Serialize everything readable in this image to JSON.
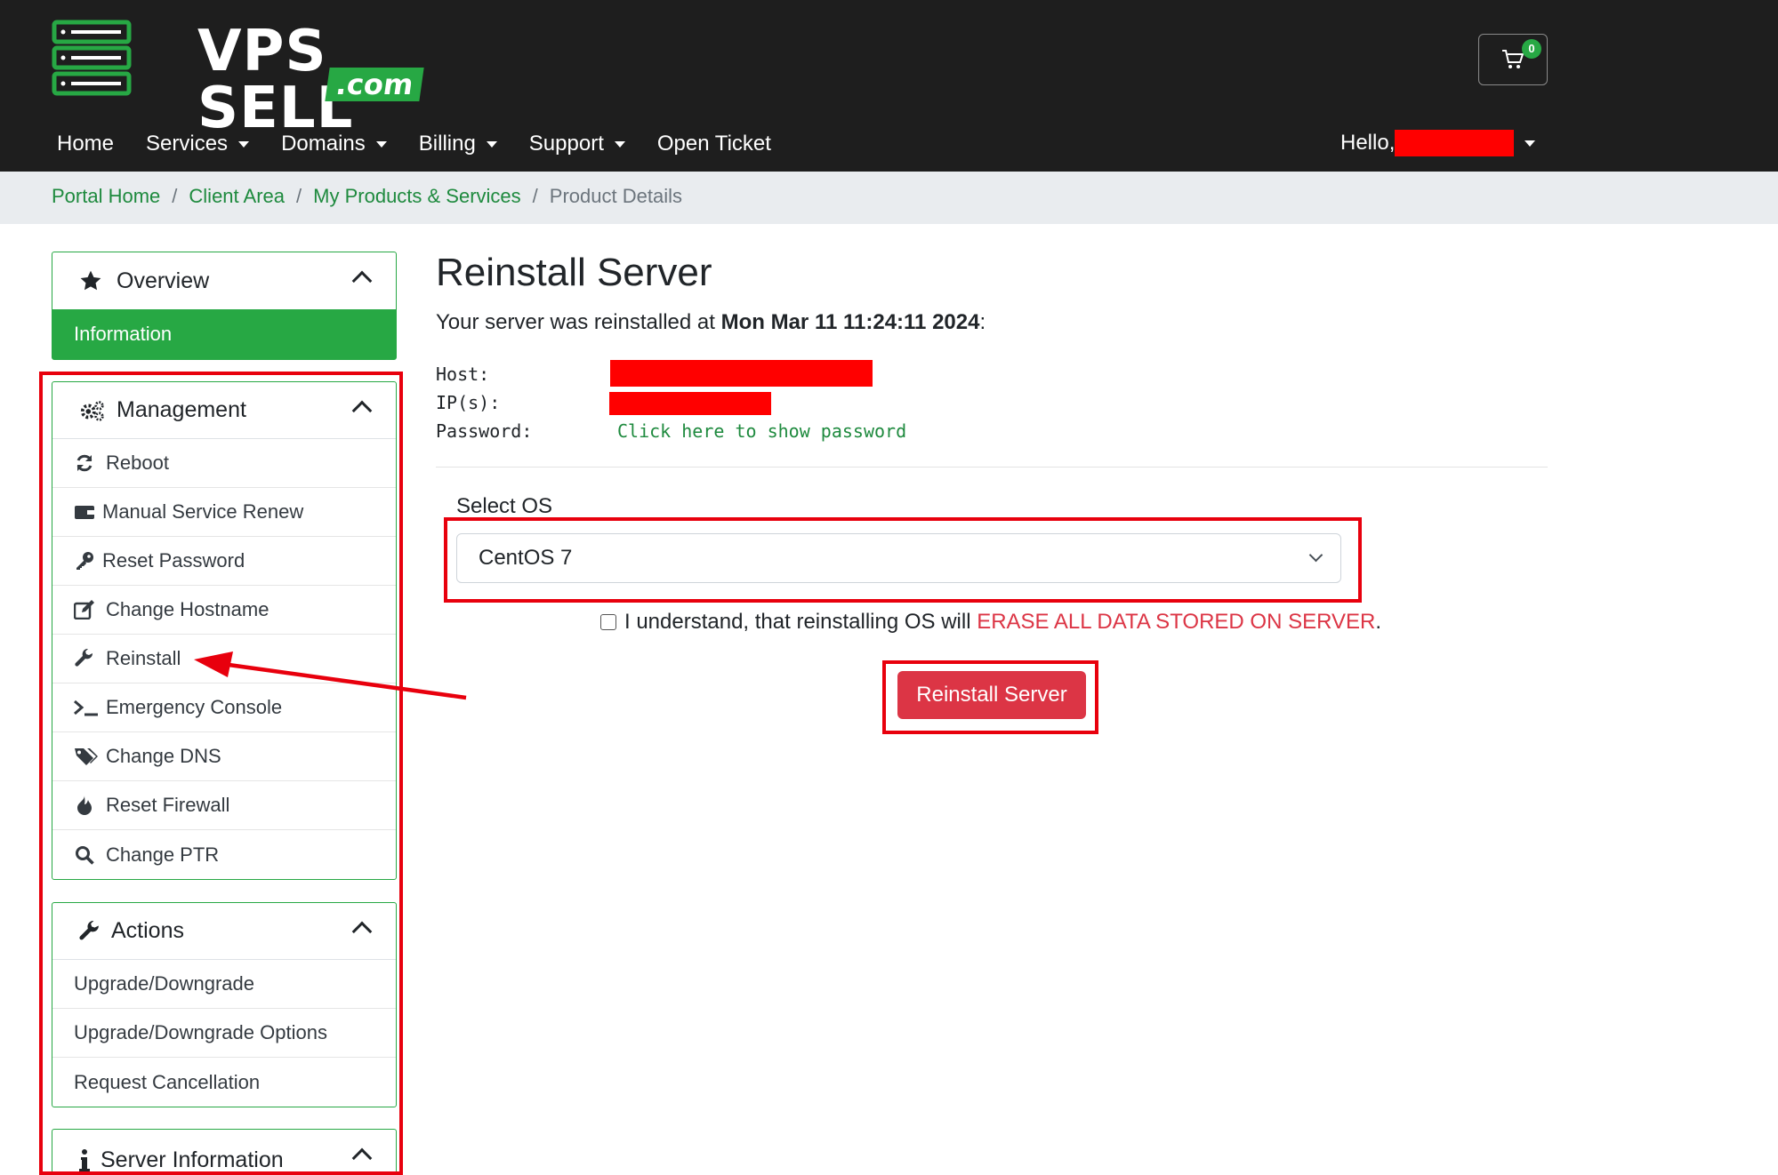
{
  "brand": {
    "name": "VPS SELL",
    "suffix": ".com"
  },
  "cart": {
    "count": "0"
  },
  "nav": {
    "items": [
      {
        "label": "Home",
        "dropdown": false
      },
      {
        "label": "Services",
        "dropdown": true
      },
      {
        "label": "Domains",
        "dropdown": true
      },
      {
        "label": "Billing",
        "dropdown": true
      },
      {
        "label": "Support",
        "dropdown": true
      },
      {
        "label": "Open Ticket",
        "dropdown": false
      }
    ],
    "greeting": "Hello,"
  },
  "breadcrumb": {
    "items": [
      "Portal Home",
      "Client Area",
      "My Products & Services"
    ],
    "current": "Product Details",
    "separator": "/"
  },
  "sidebar": {
    "overview": {
      "title": "Overview",
      "icon": "star-icon",
      "active_item": "Information"
    },
    "management": {
      "title": "Management",
      "icon": "gears-icon",
      "items": [
        {
          "label": "Reboot",
          "icon": "sync-icon"
        },
        {
          "label": "Manual Service Renew",
          "icon": "wallet-icon"
        },
        {
          "label": "Reset Password",
          "icon": "key-icon"
        },
        {
          "label": "Change Hostname",
          "icon": "edit-icon"
        },
        {
          "label": "Reinstall",
          "icon": "wrench-icon"
        },
        {
          "label": "Emergency Console",
          "icon": "terminal-icon"
        },
        {
          "label": "Change DNS",
          "icon": "tags-icon"
        },
        {
          "label": "Reset Firewall",
          "icon": "fire-icon"
        },
        {
          "label": "Change PTR",
          "icon": "search-icon"
        }
      ]
    },
    "actions": {
      "title": "Actions",
      "icon": "wrench-icon",
      "items": [
        {
          "label": "Upgrade/Downgrade"
        },
        {
          "label": "Upgrade/Downgrade Options"
        },
        {
          "label": "Request Cancellation"
        }
      ]
    },
    "server_information": {
      "title": "Server Information",
      "icon": "info-icon"
    }
  },
  "main": {
    "title": "Reinstall Server",
    "reinstall_prefix": "Your server was reinstalled at ",
    "reinstall_date": "Mon Mar 11 11:24:11 2024",
    "reinstall_suffix": ":",
    "host_label": "Host:",
    "ip_label": "IP(s):",
    "password_label": "Password:",
    "password_link": "Click here to show password",
    "select_label": "Select OS",
    "select_value": "CentOS 7",
    "agree_text": "I understand, that reinstalling OS will ",
    "agree_warning": "ERASE ALL DATA STORED ON SERVER",
    "agree_end": ".",
    "submit_label": "Reinstall Server"
  },
  "colors": {
    "accent": "#27a844",
    "header": "#1e1e1e",
    "danger": "#dc3545",
    "annotation": "#e8000d"
  }
}
